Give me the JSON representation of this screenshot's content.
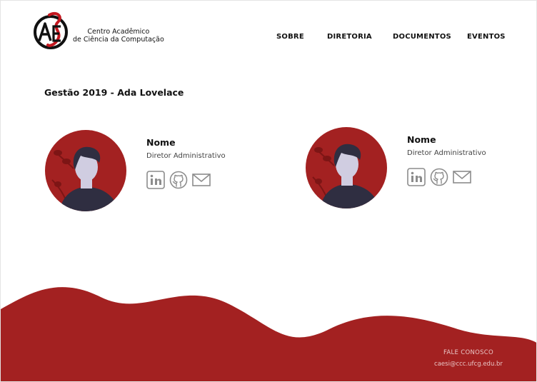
{
  "brand": {
    "line1": "Centro Acadêmico",
    "line2": "de Ciência da Computação"
  },
  "nav": {
    "items": [
      {
        "label": "SOBRE"
      },
      {
        "label": "DIRETORIA"
      },
      {
        "label": "DOCUMENTOS"
      },
      {
        "label": "EVENTOS"
      }
    ]
  },
  "section": {
    "title": "Gestão 2019 - Ada Lovelace"
  },
  "members": [
    {
      "name": "Nome",
      "role": "Diretor Administrativo",
      "icons": [
        "linkedin-icon",
        "github-icon",
        "email-icon"
      ]
    },
    {
      "name": "Nome",
      "role": "Diretor Administrativo",
      "icons": [
        "linkedin-icon",
        "github-icon",
        "email-icon"
      ]
    }
  ],
  "footer": {
    "title": "FALE CONOSCO",
    "email": "caesi@ccc.ufcg.edu.br"
  },
  "colors": {
    "accent": "#a32121",
    "dark": "#111111",
    "avatar_body": "#2f2e41",
    "avatar_skin": "#d0cde1",
    "icon_gray": "#8c8c8c"
  }
}
